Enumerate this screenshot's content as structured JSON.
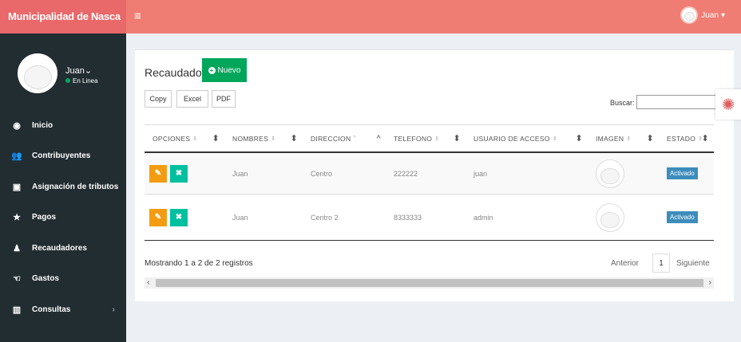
{
  "app": {
    "brand": "Municipalidad de Nasca",
    "menu_toggle": "≡"
  },
  "topnav": {
    "user": "Juan",
    "caret": "▾"
  },
  "sidebar": {
    "profile": {
      "name": "Juan",
      "caret": "⌄",
      "status": "En Linea"
    },
    "items": [
      {
        "label": "Inicio",
        "icon": "dashboard-icon",
        "glyph": "◉"
      },
      {
        "label": "Contribuyentes",
        "icon": "users-icon",
        "glyph": "👥"
      },
      {
        "label": "Asignación de tributos",
        "icon": "money-icon",
        "glyph": "▣"
      },
      {
        "label": "Pagos",
        "icon": "star-icon",
        "glyph": "★"
      },
      {
        "label": "Recaudadores",
        "icon": "user-icon",
        "glyph": "♟"
      },
      {
        "label": "Gastos",
        "icon": "hand-icon",
        "glyph": "☜"
      },
      {
        "label": "Consultas",
        "icon": "chart-icon",
        "glyph": "▥",
        "chevron": "›"
      }
    ]
  },
  "main": {
    "title": "Recaudador",
    "new_button": "Nuevo",
    "new_icon_glyph": "+",
    "export_buttons": [
      "Copy",
      "Excel",
      "PDF"
    ],
    "search_label": "Buscar:",
    "search_value": "",
    "table": {
      "columns": [
        "OPCIONES",
        "NOMBRES",
        "DIRECCION",
        "TELEFONO",
        "USUARIO DE ACCESO",
        "IMAGEN",
        "ESTADO"
      ],
      "sort_glyph": "⬍",
      "sort_small_glyph": "⇕",
      "sort_active_glyph": "^",
      "action_glyphs": {
        "edit": "✎",
        "delete": "✖"
      },
      "rows": [
        {
          "nombres": "Juan",
          "direccion": "Centro",
          "telefono": "222222",
          "usuario": "juan",
          "estado": "Activado"
        },
        {
          "nombres": "Juan",
          "direccion": "Centro 2",
          "telefono": "8333333",
          "usuario": "admin",
          "estado": "Activado"
        }
      ]
    },
    "info": "Mostrando 1 a 2 de 2 registros",
    "pagination": {
      "prev": "Anterior",
      "page": "1",
      "next": "Siguiente"
    },
    "scroll_arrows": {
      "left": "‹",
      "right": "›"
    }
  },
  "settings_glyph": "✺",
  "colors": {
    "topbar": "#f07d74",
    "sidebar": "#222d32",
    "success": "#00a65a",
    "warning": "#f39c12",
    "teal": "#00c0a0",
    "badge": "#3c8dbc"
  }
}
